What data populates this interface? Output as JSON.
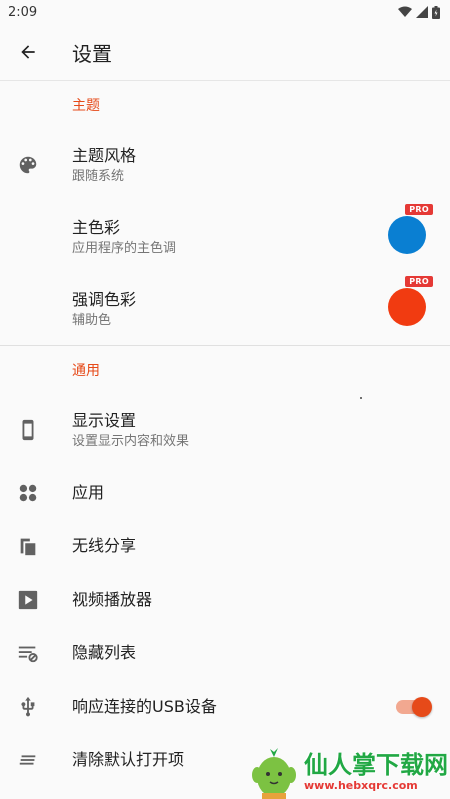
{
  "status_bar": {
    "time": "2:09"
  },
  "appbar": {
    "title": "设置"
  },
  "sections": {
    "theme": {
      "header": "主题"
    },
    "general": {
      "header": "通用"
    }
  },
  "items": {
    "theme_style": {
      "title": "主题风格",
      "subtitle": "跟随系统"
    },
    "primary_color": {
      "title": "主色彩",
      "subtitle": "应用程序的主色调",
      "badge": "PRO",
      "color": "#0a7fd2"
    },
    "accent_color": {
      "title": "强调色彩",
      "subtitle": "辅助色",
      "badge": "PRO",
      "color": "#f13b11"
    },
    "display": {
      "title": "显示设置",
      "subtitle": "设置显示内容和效果"
    },
    "apps": {
      "title": "应用"
    },
    "wireless_share": {
      "title": "无线分享"
    },
    "video_player": {
      "title": "视频播放器"
    },
    "hidden_list": {
      "title": "隐藏列表"
    },
    "usb": {
      "title": "响应连接的USB设备",
      "toggle_on": true
    },
    "clear_defaults": {
      "title": "清除默认打开项"
    }
  },
  "watermark": {
    "name": "仙人掌下载网",
    "url": "www.hebxqrc.com"
  },
  "colors": {
    "accent": "#e64a19",
    "icon_gray": "#616161"
  }
}
